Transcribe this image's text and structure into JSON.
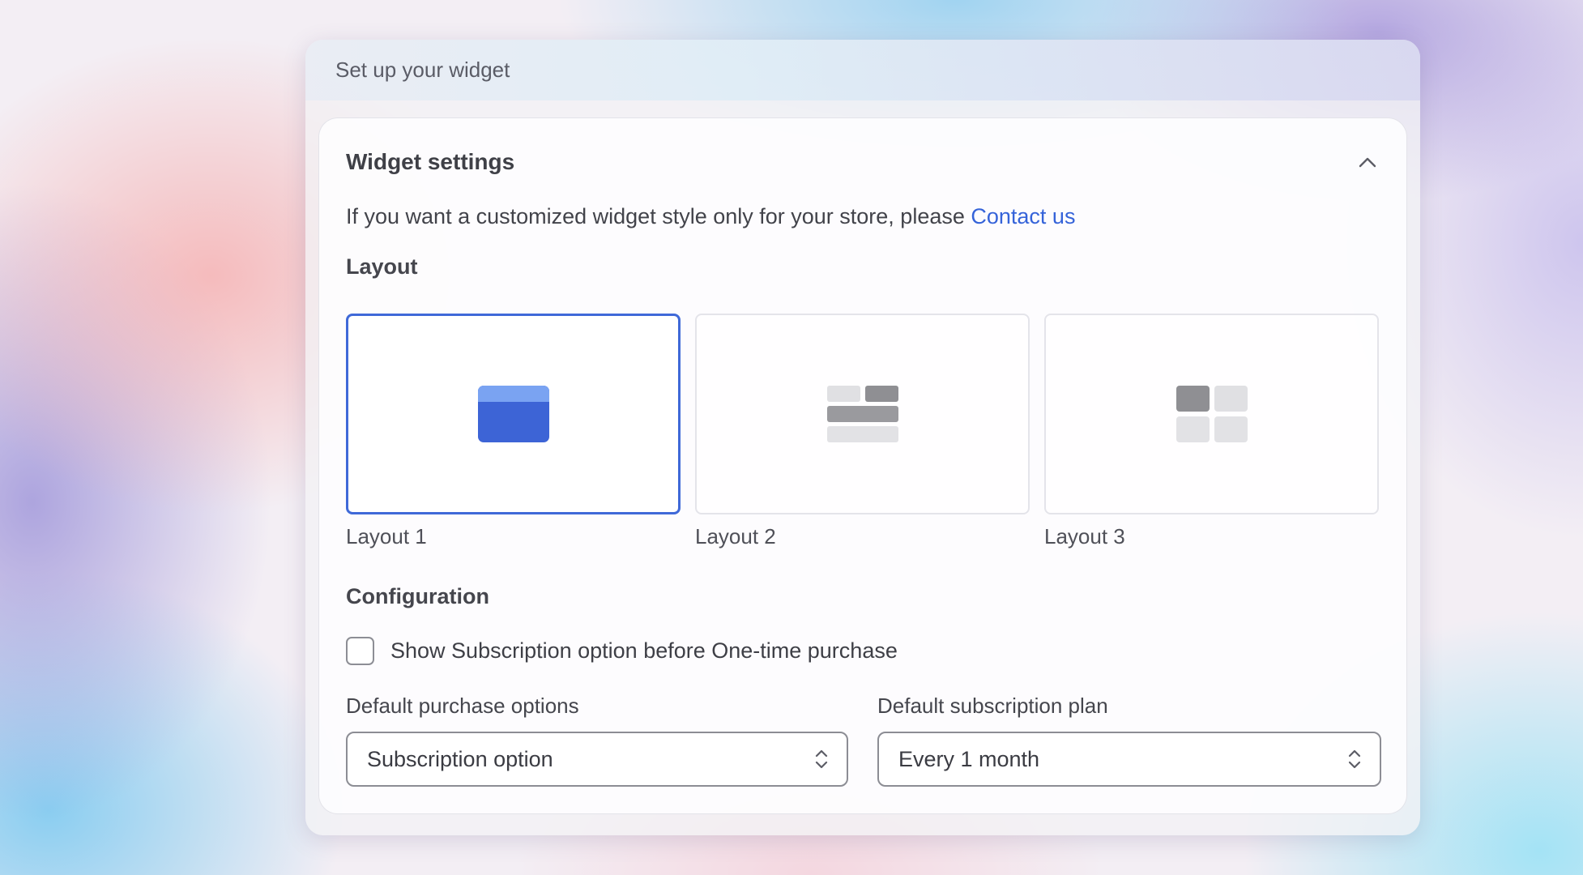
{
  "window": {
    "title": "Set up your widget"
  },
  "settings": {
    "title": "Widget settings",
    "collapse_icon": "chevron-up-icon",
    "intro_text": "If you want a customized widget style only for your store, please ",
    "contact_link": "Contact us"
  },
  "layout_section": {
    "label": "Layout",
    "options": [
      {
        "label": "Layout 1",
        "selected": true,
        "icon": "single-card-layout-icon"
      },
      {
        "label": "Layout 2",
        "selected": false,
        "icon": "stacked-rows-layout-icon"
      },
      {
        "label": "Layout 3",
        "selected": false,
        "icon": "grid-layout-icon"
      }
    ]
  },
  "configuration": {
    "label": "Configuration",
    "checkbox_label": "Show Subscription option before One-time purchase",
    "checkbox_checked": false,
    "purchase_options": {
      "label": "Default purchase options",
      "value": "Subscription option"
    },
    "subscription_plan": {
      "label": "Default subscription plan",
      "value": "Every 1 month"
    }
  },
  "colors": {
    "accent": "#3f69d8",
    "link": "#3563d9"
  }
}
